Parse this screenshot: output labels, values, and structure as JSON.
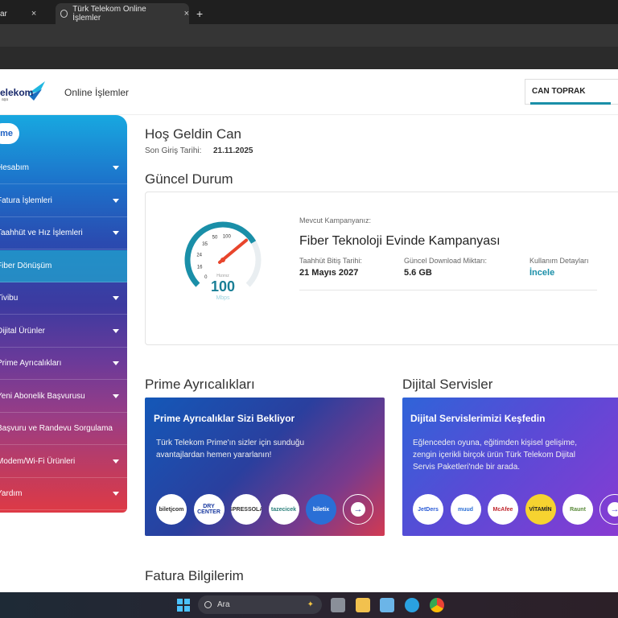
{
  "browser": {
    "tabs": [
      {
        "label": "ar"
      },
      {
        "label": "Türk Telekom Online İşlemler"
      }
    ],
    "close_glyph": "×",
    "new_tab_glyph": "+"
  },
  "header": {
    "logo_text": "elekom",
    "logo_sub": "aşa",
    "title": "Online İşlemler",
    "user_name": "CAN TOPRAK"
  },
  "sidebar": {
    "home_label": "me",
    "items": [
      {
        "label": "Hesabım",
        "caret": true
      },
      {
        "label": "Fatura İşlemleri",
        "caret": true
      },
      {
        "label": "Taahhüt ve Hız İşlemleri",
        "caret": true
      },
      {
        "label": "Fiber Dönüşüm",
        "caret": false,
        "active": true
      },
      {
        "label": "Tivibu",
        "caret": true
      },
      {
        "label": "Dijital Ürünler",
        "caret": true
      },
      {
        "label": "Prime Ayrıcalıkları",
        "caret": true
      },
      {
        "label": "Yeni Abonelik Başvurusu",
        "caret": true
      },
      {
        "label": "Başvuru ve Randevu Sorgulama",
        "caret": false
      },
      {
        "label": "Modem/Wi-Fi Ürünleri",
        "caret": true
      },
      {
        "label": "Yardım",
        "caret": true
      }
    ]
  },
  "main": {
    "welcome": "Hoş Geldin Can",
    "last_login_label": "Son Giriş Tarihi:",
    "last_login_value": "21.11.2025",
    "status_title": "Güncel Durum",
    "gauge": {
      "ticks": [
        "0",
        "16",
        "24",
        "35",
        "50",
        "100"
      ],
      "caption": "Hızınız",
      "value": "100",
      "unit": "Mbps",
      "level": 100,
      "max": 100
    },
    "campaign_label": "Mevcut Kampanyanız:",
    "campaign_name": "Fiber Teknoloji Evinde Kampanyası",
    "info": [
      {
        "label": "Taahhüt Bitiş Tarihi:",
        "value": "21 Mayıs 2027"
      },
      {
        "label": "Güncel Download Miktarı:",
        "value": "5.6 GB"
      },
      {
        "label": "Kullanım Detayları",
        "value": "İncele"
      }
    ],
    "prime_section_title": "Prime Ayrıcalıkları",
    "dijital_section_title": "Dijital Servisler",
    "prime_card": {
      "heading": "Prime Ayrıcalıklar Sizi Bekliyor",
      "text": "Türk Telekom Prime'ın sizler için sunduğu avantajlardan hemen yararlanın!",
      "brands": [
        "biletjcom",
        "DRY CENTER",
        "ESPRESSOLAB",
        "tazecicek",
        "biletix"
      ]
    },
    "dijital_card": {
      "heading": "Dijital Servislerimizi Keşfedin",
      "text": "Eğlenceden oyuna, eğitimden kişisel gelişime, zengin içerikli birçok ürün Türk Telekom Dijital Servis Paketleri'nde bir arada.",
      "brands": [
        "JetDers",
        "muud",
        "McAfee",
        "VİTAMİN",
        "Raunt"
      ]
    },
    "fatura_title": "Fatura Bilgilerim"
  },
  "taskbar": {
    "search_placeholder": "Ara"
  },
  "colors": {
    "accent": "#1a8fa8",
    "sidebar_top": "#18a8e0",
    "sidebar_bottom": "#de3a45",
    "gauge_needle": "#e8452c"
  }
}
